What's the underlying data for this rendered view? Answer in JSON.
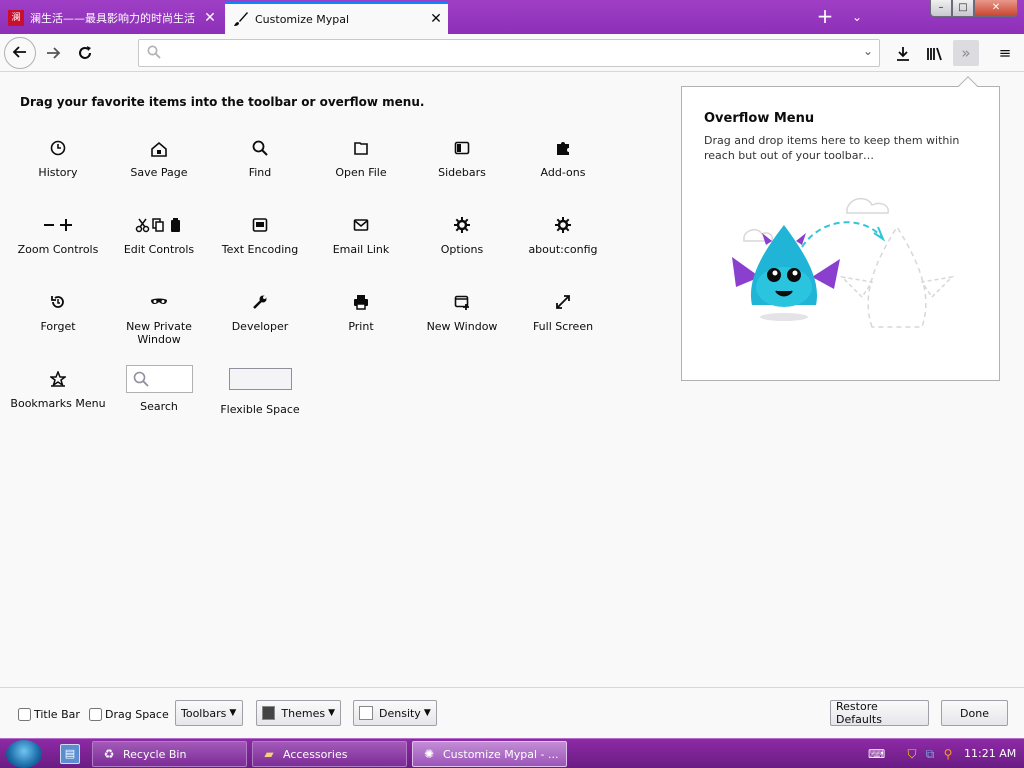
{
  "tabs": [
    {
      "title": "澜生活——最具影响力的时尚生活",
      "favicon_text": "澜",
      "active": false
    },
    {
      "title": "Customize Mypal",
      "active": true
    }
  ],
  "window_controls": {
    "minimize": "–",
    "maximize": "□",
    "close": "✕"
  },
  "navbar": {
    "url_value": "",
    "url_placeholder": ""
  },
  "heading": "Drag your favorite items into the toolbar or overflow menu.",
  "palette": [
    {
      "label": "History",
      "icon": "history-icon",
      "glyph": "🕘"
    },
    {
      "label": "Save Page",
      "icon": "save-page-icon",
      "glyph": "⬇"
    },
    {
      "label": "Find",
      "icon": "find-icon",
      "glyph": "🔍"
    },
    {
      "label": "Open File",
      "icon": "open-file-icon",
      "glyph": "📂"
    },
    {
      "label": "Sidebars",
      "icon": "sidebars-icon",
      "glyph": "▯"
    },
    {
      "label": "Add-ons",
      "icon": "addons-icon",
      "glyph": "✚"
    },
    {
      "label": "Zoom Controls",
      "icon": "zoom-controls-icon",
      "glyph": "− +"
    },
    {
      "label": "Edit Controls",
      "icon": "edit-controls-icon",
      "glyph": "✂ ⎘ 📋"
    },
    {
      "label": "Text Encoding",
      "icon": "text-encoding-icon",
      "glyph": "▣"
    },
    {
      "label": "Email Link",
      "icon": "email-link-icon",
      "glyph": "✉"
    },
    {
      "label": "Options",
      "icon": "options-icon",
      "glyph": "⚙"
    },
    {
      "label": "about:config",
      "icon": "about-config-icon",
      "glyph": "⚙"
    },
    {
      "label": "Forget",
      "icon": "forget-icon",
      "glyph": "↺"
    },
    {
      "label": "New Private Window",
      "icon": "private-window-icon",
      "glyph": "∞"
    },
    {
      "label": "Developer",
      "icon": "developer-icon",
      "glyph": "🔧"
    },
    {
      "label": "Print",
      "icon": "print-icon",
      "glyph": "🖶"
    },
    {
      "label": "New Window",
      "icon": "new-window-icon",
      "glyph": "⊞"
    },
    {
      "label": "Full Screen",
      "icon": "full-screen-icon",
      "glyph": "⤢"
    },
    {
      "label": "Bookmarks Menu",
      "icon": "bookmarks-menu-icon",
      "glyph": "☆"
    },
    {
      "label": "Search",
      "icon": "search-icon",
      "glyph": ""
    },
    {
      "label": "Flexible Space",
      "icon": "flexible-space-icon",
      "glyph": ""
    }
  ],
  "overflow": {
    "title": "Overflow Menu",
    "description": "Drag and drop items here to keep them within reach but out of your toolbar…"
  },
  "bottombar": {
    "title_bar": "Title Bar",
    "drag_space": "Drag Space",
    "toolbars": "Toolbars",
    "themes": "Themes",
    "density": "Density",
    "restore": "Restore Defaults",
    "done": "Done"
  },
  "taskbar": {
    "items": [
      {
        "label": "Recycle Bin"
      },
      {
        "label": "Accessories"
      },
      {
        "label": "Customize Mypal - ..."
      }
    ],
    "clock": "11:21 AM"
  },
  "colors": {
    "accent": "#0a84ff",
    "tabstrip": "#9f3fc6",
    "taskbar": "#7c2c96"
  }
}
